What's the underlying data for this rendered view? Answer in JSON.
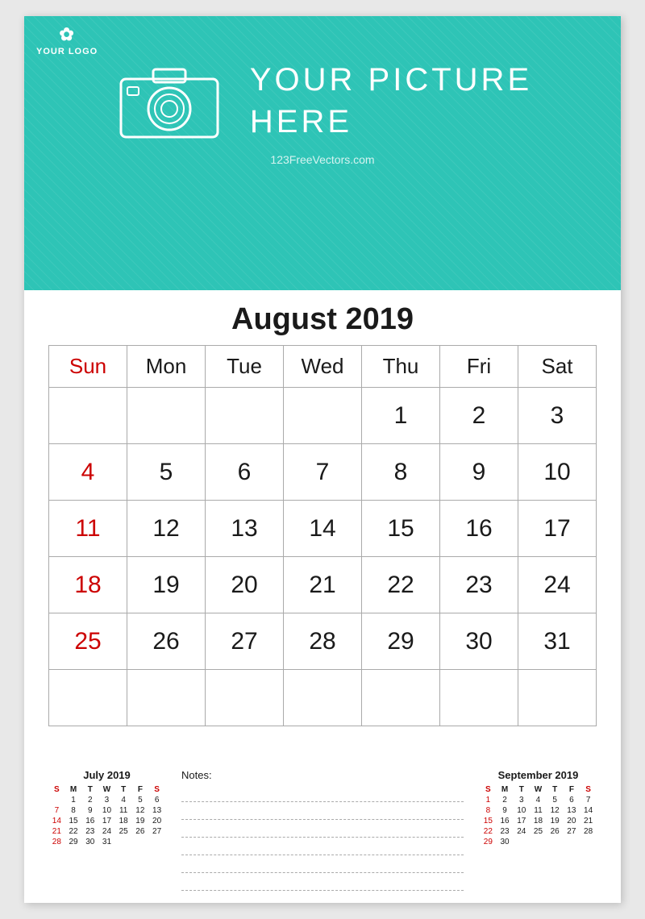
{
  "header": {
    "logo_text": "YOUR LOGO",
    "picture_text_line1": "YOUR  PICTURE",
    "picture_text_line2": "HERE",
    "watermark": "123FreeVectors.com"
  },
  "calendar": {
    "month_title": "August 2019",
    "days_header": [
      "Sun",
      "Mon",
      "Tue",
      "Wed",
      "Thu",
      "Fri",
      "Sat"
    ],
    "weeks": [
      [
        "",
        "",
        "",
        "",
        "1",
        "2",
        "3"
      ],
      [
        "4",
        "5",
        "6",
        "7",
        "8",
        "9",
        "10"
      ],
      [
        "11",
        "12",
        "13",
        "14",
        "15",
        "16",
        "17"
      ],
      [
        "18",
        "19",
        "20",
        "21",
        "22",
        "23",
        "24"
      ],
      [
        "25",
        "26",
        "27",
        "28",
        "29",
        "30",
        "31"
      ],
      [
        "",
        "",
        "",
        "",
        "",
        "",
        ""
      ]
    ]
  },
  "notes_label": "Notes:",
  "mini_july": {
    "title": "July 2019",
    "headers": [
      "S",
      "M",
      "T",
      "W",
      "T",
      "F",
      "S"
    ],
    "weeks": [
      [
        "",
        "1",
        "2",
        "3",
        "4",
        "5",
        "6"
      ],
      [
        "7",
        "8",
        "9",
        "10",
        "11",
        "12",
        "13"
      ],
      [
        "14",
        "15",
        "16",
        "17",
        "18",
        "19",
        "20"
      ],
      [
        "21",
        "22",
        "23",
        "24",
        "25",
        "26",
        "27"
      ],
      [
        "28",
        "29",
        "30",
        "31",
        "",
        "",
        ""
      ]
    ]
  },
  "mini_sep": {
    "title": "September 2019",
    "headers": [
      "S",
      "M",
      "T",
      "W",
      "T",
      "F",
      "S"
    ],
    "weeks": [
      [
        "1",
        "2",
        "3",
        "4",
        "5",
        "6",
        "7"
      ],
      [
        "8",
        "9",
        "10",
        "11",
        "12",
        "13",
        "14"
      ],
      [
        "15",
        "16",
        "17",
        "18",
        "19",
        "20",
        "21"
      ],
      [
        "22",
        "23",
        "24",
        "25",
        "26",
        "27",
        "28"
      ],
      [
        "29",
        "30",
        "",
        "",
        "",
        "",
        ""
      ]
    ]
  }
}
